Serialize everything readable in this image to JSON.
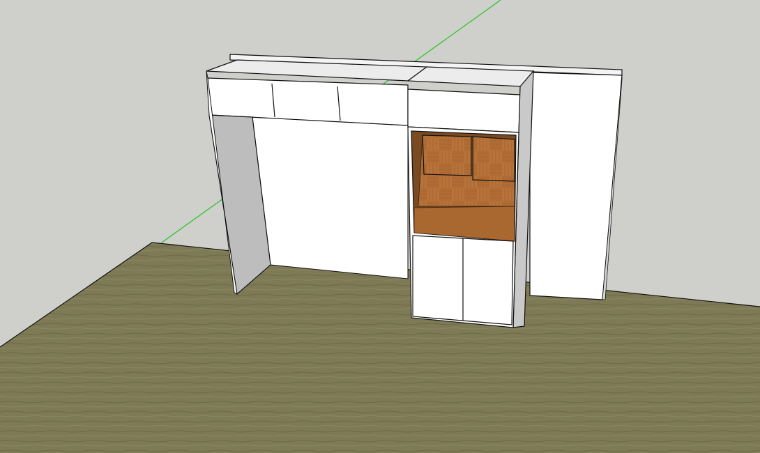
{
  "scene": {
    "kind": "3d-model-viewport",
    "colors": {
      "background": "#cfcfcb",
      "floor": "#7d7a55",
      "floor_dark": "#5f5c3e",
      "panel_white": "#ffffff",
      "panel_shade": "#e4e4e4",
      "side_grey": "#bdbdbd",
      "edge": "#111111",
      "green_axis": "#22c422",
      "wood": "#b8733a",
      "wood_dark": "#7a4a22"
    },
    "objects": [
      "floor",
      "back-wall-panel",
      "overhead-cabinet-left",
      "tall-cabinet-right",
      "wood-niche",
      "lower-doors"
    ]
  }
}
